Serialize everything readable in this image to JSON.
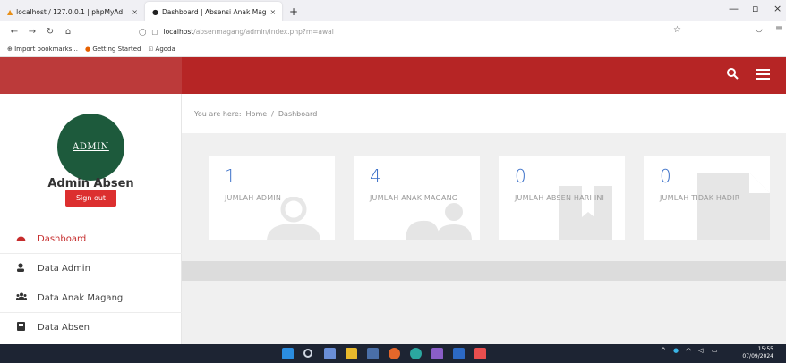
{
  "browser": {
    "tabs": [
      {
        "label": "localhost / 127.0.0.1 | phpMyAd",
        "active": false
      },
      {
        "label": "Dashboard | Absensi Anak Mag",
        "active": true
      }
    ],
    "new_tab": "+",
    "url_host": "localhost",
    "url_path": "/absenmagang/admin/index.php?m=awal",
    "bookmarks": [
      "Import bookmarks...",
      "Getting Started",
      "Agoda"
    ]
  },
  "header": {
    "accent": "#b62525",
    "search_icon": "search-icon",
    "menu_icon": "hamburger-icon"
  },
  "sidebar": {
    "avatar_text": "ADMIN",
    "user_name": "Admin Absen",
    "signout_label": "Sign out",
    "items": [
      {
        "label": "Dashboard",
        "icon": "tachometer-icon",
        "active": true
      },
      {
        "label": "Data Admin",
        "icon": "user-icon",
        "active": false
      },
      {
        "label": "Data Anak Magang",
        "icon": "users-icon",
        "active": false
      },
      {
        "label": "Data Absen",
        "icon": "book-icon",
        "active": false
      }
    ]
  },
  "main": {
    "breadcrumb": {
      "prefix": "You are here:",
      "home": "Home",
      "sep": "/",
      "current": "Dashboard"
    },
    "cards": [
      {
        "value": "1",
        "label": "JUMLAH ADMIN",
        "icon": "user-icon"
      },
      {
        "value": "4",
        "label": "JUMLAH ANAK MAGANG",
        "icon": "users-icon"
      },
      {
        "value": "0",
        "label": "JUMLAH ABSEN HARI INI",
        "icon": "book-icon"
      },
      {
        "value": "0",
        "label": "JUMLAH TIDAK HADIR",
        "icon": "file-icon"
      }
    ]
  },
  "taskbar": {
    "time": "15:55",
    "date": "07/09/2024"
  }
}
